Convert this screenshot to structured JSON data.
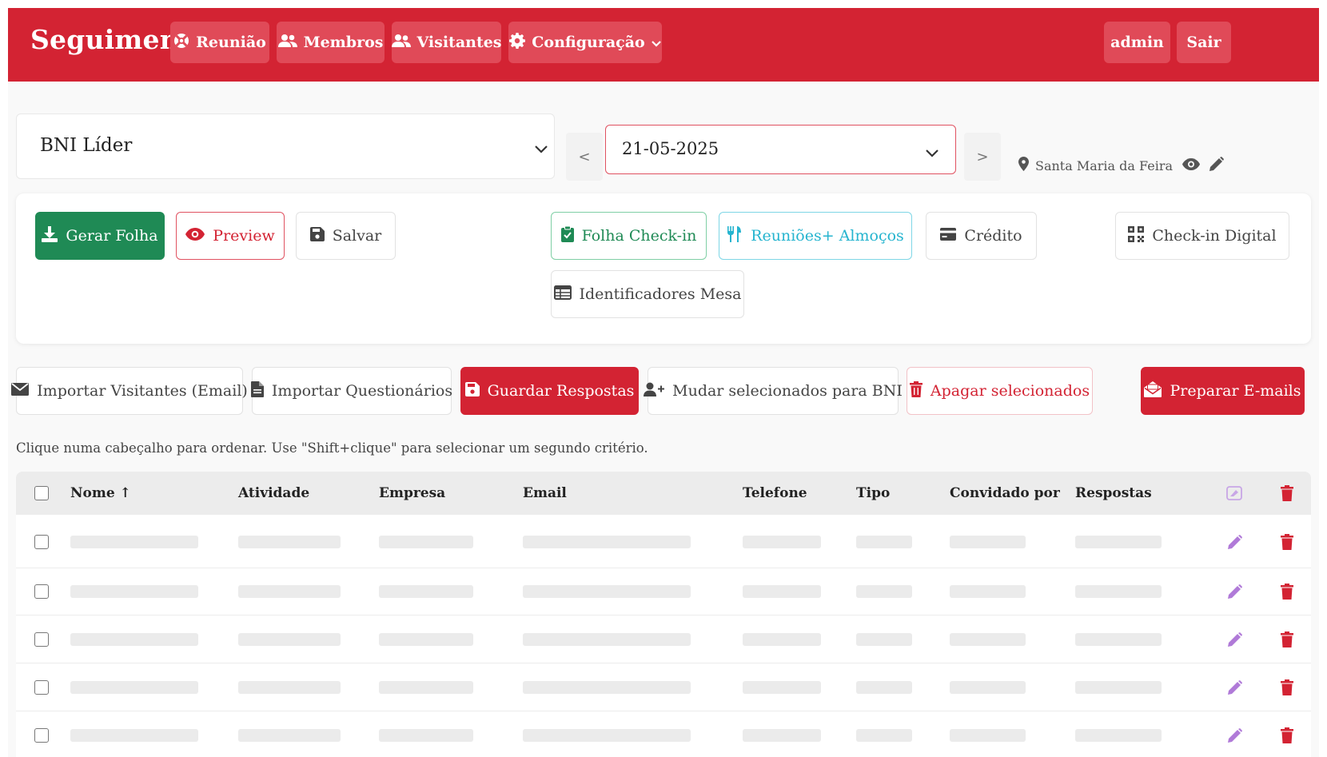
{
  "navbar": {
    "brand": "Seguimento",
    "items": [
      {
        "label": "Reunião",
        "icon": "life-ring-icon"
      },
      {
        "label": "Membros",
        "icon": "users-icon"
      },
      {
        "label": "Visitantes",
        "icon": "user-friends-icon"
      },
      {
        "label": "Configuração",
        "icon": "gear-icon"
      }
    ],
    "user": "admin",
    "logout": "Sair",
    "color": "#d32333"
  },
  "selectors": {
    "group": "BNI Líder",
    "date": "21-05-2025",
    "prev": "<",
    "next": ">",
    "location": "Santa Maria da Feira"
  },
  "actions": {
    "gerar_folha": "Gerar Folha",
    "preview": "Preview",
    "salvar": "Salvar",
    "folha_checkin": "Folha Check-in",
    "reunioes_almocos": "Reuniões+ Almoços",
    "credito": "Crédito",
    "checkin_digital": "Check-in Digital",
    "identificadores_mesa": "Identificadores Mesa"
  },
  "toolbar": {
    "importar_visitantes": "Importar Visitantes (Email)",
    "importar_questionarios": "Importar Questionários",
    "guardar_respostas": "Guardar Respostas",
    "mudar_selecionados": "Mudar selecionados para BNI",
    "apagar_selecionados": "Apagar selecionados",
    "preparar_emails": "Preparar E-mails"
  },
  "hint": "Clique numa cabeçalho para ordenar. Use \"Shift+clique\" para selecionar um segundo critério.",
  "table": {
    "columns": [
      "Nome ↑",
      "Atividade",
      "Empresa",
      "Email",
      "Telefone",
      "Tipo",
      "Convidado por",
      "Respostas"
    ],
    "row_count": 5
  }
}
